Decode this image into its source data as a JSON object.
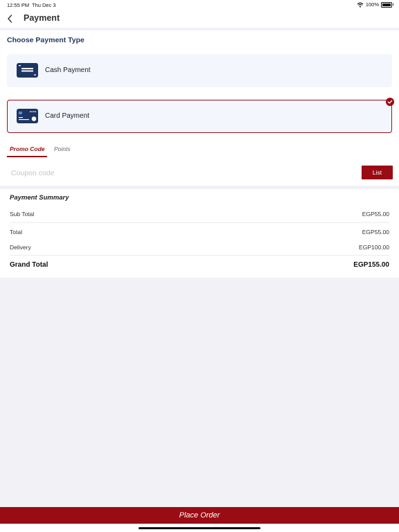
{
  "status_bar": {
    "time": "12:55 PM",
    "date": "Thu Dec 3",
    "battery": "100%"
  },
  "nav": {
    "title": "Payment"
  },
  "payment": {
    "section_title": "Choose Payment Type",
    "options": [
      {
        "label": "Cash Payment",
        "icon": "cash-icon",
        "selected": false
      },
      {
        "label": "Card Payment",
        "icon": "credit-card-icon",
        "selected": true
      }
    ]
  },
  "tabs": [
    {
      "label": "Promo Code",
      "active": true
    },
    {
      "label": "Points",
      "active": false
    }
  ],
  "coupon": {
    "value": "",
    "placeholder": "Coupon code",
    "list_label": "List"
  },
  "summary": {
    "title": "Payment Summary",
    "rows": [
      {
        "label": "Sub Total",
        "value": "EGP55.00"
      },
      {
        "label": "Total",
        "value": "EGP55.00"
      },
      {
        "label": "Delivery",
        "value": "EGP100.00"
      }
    ],
    "grand_total": {
      "label": "Grand Total",
      "value": "EGP155.00"
    }
  },
  "footer": {
    "place_order_label": "Place Order"
  },
  "colors": {
    "brand_red": "#9a0c14",
    "navy": "#213a66",
    "option_bg": "#f3f6fc",
    "page_bg": "#f1f1f6"
  }
}
